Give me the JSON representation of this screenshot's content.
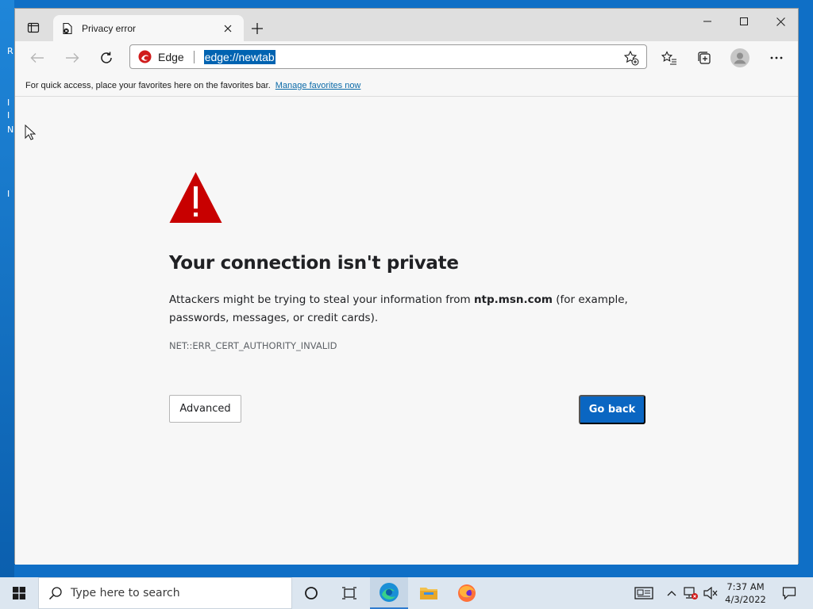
{
  "desktop": {
    "fragments": [
      "R",
      "I",
      "I",
      "N",
      "I"
    ]
  },
  "browser": {
    "tab": {
      "title": "Privacy error"
    },
    "address": {
      "brand_label": "Edge",
      "url": "edge://newtab"
    },
    "favorites_bar": {
      "message": "For quick access, place your favorites here on the favorites bar.",
      "link": "Manage favorites now"
    }
  },
  "error_page": {
    "heading": "Your connection isn't private",
    "message_before": "Attackers might be trying to steal your information from ",
    "host": "ntp.msn.com",
    "message_after": " (for example, passwords, messages, or credit cards).",
    "error_code": "NET::ERR_CERT_AUTHORITY_INVALID",
    "advanced_label": "Advanced",
    "go_back_label": "Go back",
    "icon_color": "#c80000",
    "primary_color": "#0a66c2"
  },
  "taskbar": {
    "search_placeholder": "Type here to search",
    "clock_time": "7:37 AM",
    "clock_date": "4/3/2022"
  }
}
